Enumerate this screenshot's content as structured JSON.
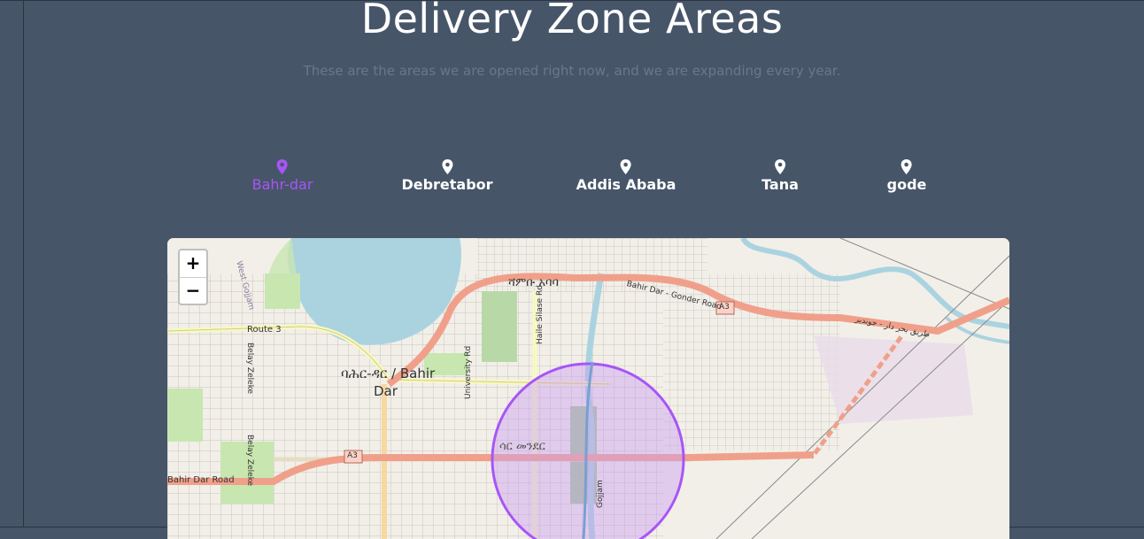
{
  "header": {
    "title": "Delivery Zone Areas",
    "subtitle": "These are the areas we are opened right now, and we are expanding every year."
  },
  "locations": {
    "active_index": 0,
    "items": [
      {
        "label": "Bahr-dar"
      },
      {
        "label": "Debretabor"
      },
      {
        "label": "Addis Ababa"
      },
      {
        "label": "Tana"
      },
      {
        "label": "gode"
      }
    ]
  },
  "map": {
    "zoom_in": "+",
    "zoom_out": "−",
    "labels": {
      "city": "ባሕር-ዳር / Bahir",
      "city2": "Dar",
      "route3": "Route 3",
      "a3_left": "A3",
      "a3_right": "A3",
      "bahir_dar_road": "Bahir Dar Road",
      "gonder_road": "Bahir Dar - Gonder Road",
      "arabic_road": "طريق بحر دار - جوندير",
      "north_area": "ሻምቡ አባባ",
      "zone_area": "ሳር መንደር",
      "west_gojjam": "West Gojjam",
      "belay_zeleke_1": "Belay Zeleke",
      "belay_zeleke_2": "Belay Zeleke",
      "university_rd": "University Rd",
      "haile_selase_rd": "Haile Silase Rd",
      "gojjam_rd": "Gojjam"
    },
    "colors": {
      "water": "#aad3df",
      "road_primary": "#f0a08a",
      "road_yellow": "#f7fabf",
      "park": "#c8e6b0",
      "zone_stroke": "#a855f7",
      "zone_fill": "#c9a0f0"
    }
  },
  "theme": {
    "background": "#475569",
    "accent": "#a855f7",
    "text": "#ffffff",
    "muted": "#6b7789"
  }
}
